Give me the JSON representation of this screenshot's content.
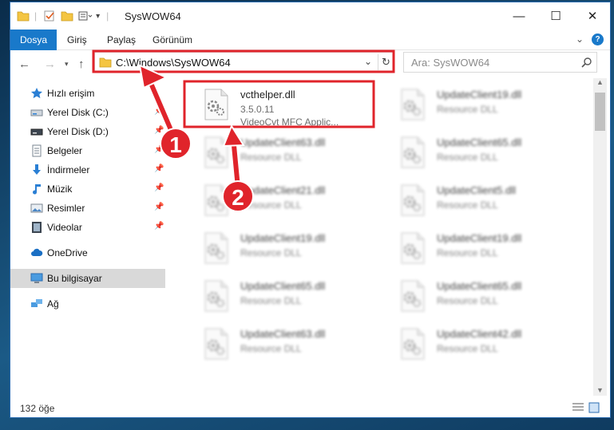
{
  "window": {
    "title": "SysWOW64"
  },
  "ribbon": {
    "tabs": [
      "Dosya",
      "Giriş",
      "Paylaş",
      "Görünüm"
    ]
  },
  "nav": {
    "address": "C:\\Windows\\SysWOW64",
    "search_placeholder": "Ara: SysWOW64"
  },
  "sidebar": {
    "items": [
      {
        "label": "Hızlı erişim",
        "icon": "star-icon",
        "pinned": false
      },
      {
        "label": "Yerel Disk (C:)",
        "icon": "drive-icon",
        "pinned": true
      },
      {
        "label": "Yerel Disk (D:)",
        "icon": "drive-icon",
        "pinned": true
      },
      {
        "label": "Belgeler",
        "icon": "document-icon",
        "pinned": true
      },
      {
        "label": "İndirmeler",
        "icon": "download-icon",
        "pinned": true
      },
      {
        "label": "Müzik",
        "icon": "music-icon",
        "pinned": true
      },
      {
        "label": "Resimler",
        "icon": "pictures-icon",
        "pinned": true
      },
      {
        "label": "Videolar",
        "icon": "video-icon",
        "pinned": true
      },
      {
        "label": "OneDrive",
        "icon": "cloud-icon",
        "pinned": false
      },
      {
        "label": "Bu bilgisayar",
        "icon": "computer-icon",
        "pinned": false,
        "selected": true
      },
      {
        "label": "Ağ",
        "icon": "network-icon",
        "pinned": false
      }
    ]
  },
  "files": [
    {
      "name": "vcthelper.dll",
      "line2": "3.5.0.11",
      "line3": "VideoCvt MFC Applic...",
      "highlighted": true
    },
    {
      "name": "UpdateClient19.dll",
      "line2": "Resource DLL",
      "line3": ""
    },
    {
      "name": "UpdateClient63.dll",
      "line2": "Resource DLL",
      "line3": ""
    },
    {
      "name": "UpdateClient65.dll",
      "line2": "Resource DLL",
      "line3": ""
    },
    {
      "name": "UpdateClient21.dll",
      "line2": "Resource DLL",
      "line3": ""
    },
    {
      "name": "UpdateClient5.dll",
      "line2": "Resource DLL",
      "line3": ""
    },
    {
      "name": "UpdateClient19.dll",
      "line2": "Resource DLL",
      "line3": ""
    },
    {
      "name": "UpdateClient19.dll",
      "line2": "Resource DLL",
      "line3": ""
    },
    {
      "name": "UpdateClient65.dll",
      "line2": "Resource DLL",
      "line3": ""
    },
    {
      "name": "UpdateClient65.dll",
      "line2": "Resource DLL",
      "line3": ""
    },
    {
      "name": "UpdateClient63.dll",
      "line2": "Resource DLL",
      "line3": ""
    },
    {
      "name": "UpdateClient42.dll",
      "line2": "Resource DLL",
      "line3": ""
    }
  ],
  "status": {
    "count": "132 öğe"
  },
  "annotations": {
    "step1": "1",
    "step2": "2"
  },
  "colors": {
    "accent": "#1979ca",
    "highlight": "#e0242b"
  }
}
